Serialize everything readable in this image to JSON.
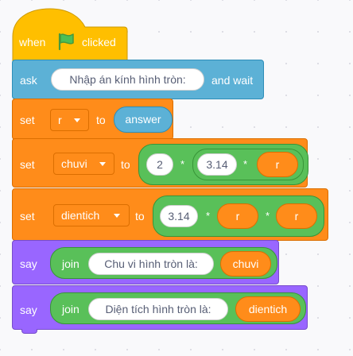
{
  "hat": {
    "when": "when",
    "clicked": "clicked"
  },
  "ask": {
    "label": "ask",
    "prompt": "Nhập án kính hình tròn:",
    "suffix": "and wait"
  },
  "set_r": {
    "label": "set",
    "var": "r",
    "to": "to",
    "value": "answer"
  },
  "set_chuvi": {
    "label": "set",
    "var": "chuvi",
    "to": "to",
    "v1": "2",
    "op1": "*",
    "v2": "3.14",
    "op2": "*",
    "v3": "r"
  },
  "set_dientich": {
    "label": "set",
    "var": "dientich",
    "to": "to",
    "v1": "3.14",
    "op1": "*",
    "v2": "r",
    "op2": "*",
    "v3": "r"
  },
  "say1": {
    "label": "say",
    "join": "join",
    "text": "Chu vi hình tròn là:",
    "var": "chuvi"
  },
  "say2": {
    "label": "say",
    "join": "join",
    "text": "Diện tích hình tròn là:",
    "var": "dientich"
  },
  "colors": {
    "events": "#ffbf00",
    "sensing": "#5cb1d6",
    "variables": "#ff8c1a",
    "operators": "#59c059",
    "looks": "#9966ff",
    "flag": "#4cbf56"
  }
}
